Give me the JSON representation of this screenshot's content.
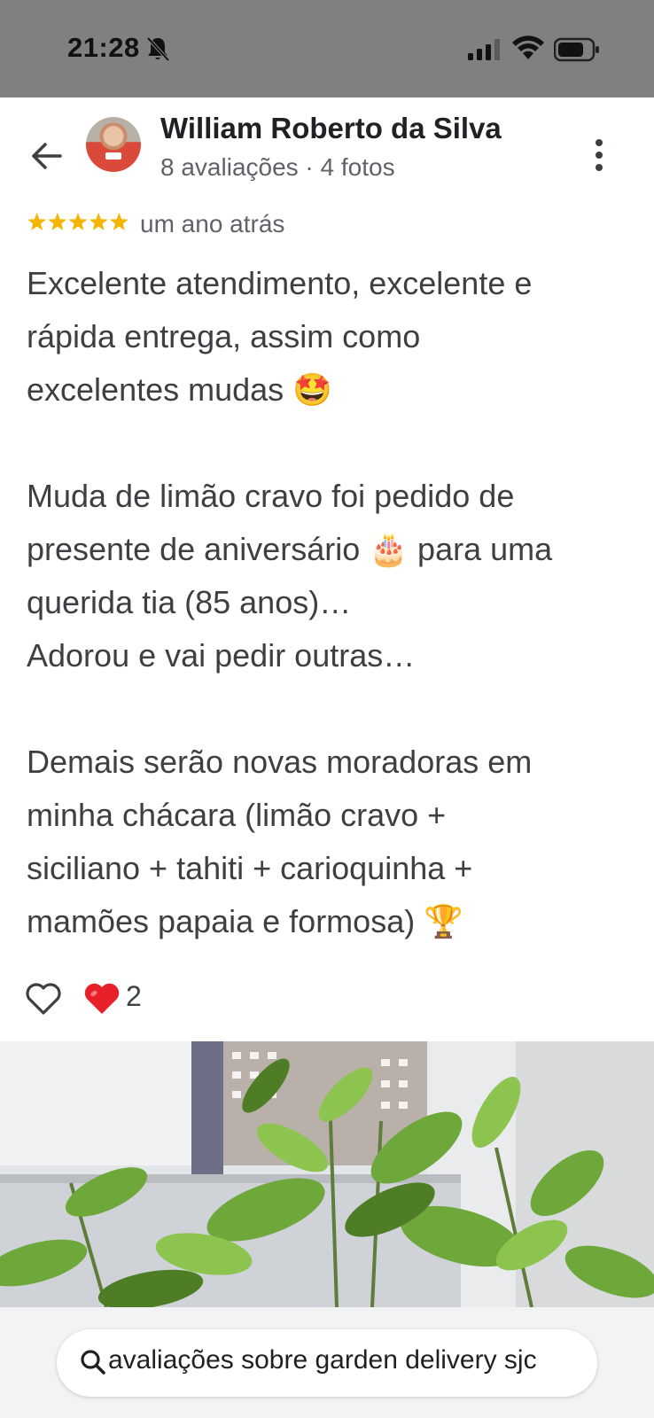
{
  "status_bar": {
    "time": "21:28",
    "icons": [
      "bell-off-icon",
      "signal-icon",
      "wifi-icon",
      "battery-icon"
    ]
  },
  "header": {
    "back_icon": "arrow-left-icon",
    "user_name": "William Roberto da Silva",
    "user_meta": "8 avaliações · 4 fotos",
    "more_icon": "more-vert-icon"
  },
  "review": {
    "rating": 5,
    "rating_max": 5,
    "star_color": "#f4b400",
    "time_ago": "um ano atrás",
    "paragraphs": [
      {
        "lines": [
          "Excelente atendimento, excelente e",
          "rápida entrega, assim como",
          "excelentes mudas 🤩"
        ]
      },
      {
        "lines": [
          "Muda de limão cravo foi pedido de",
          "presente de aniversário 🎂 para uma",
          "querida tia (85 anos)…",
          "Adorou e vai pedir outras…"
        ]
      },
      {
        "lines": [
          "Demais serão novas moradoras em",
          "minha chácara (limão cravo +",
          "siciliano + tahiti + carioquinha +",
          "mamões papaia e formosa) 🏆"
        ]
      }
    ]
  },
  "reactions": {
    "like_icon": "heart-outline-icon",
    "reaction_icon": "red-heart-icon",
    "reaction_color": "#e8202a",
    "count": "2"
  },
  "photo": {
    "subject": "lemon tree seedlings"
  },
  "search": {
    "icon": "search-icon",
    "text": "avaliações sobre garden delivery sjc"
  }
}
